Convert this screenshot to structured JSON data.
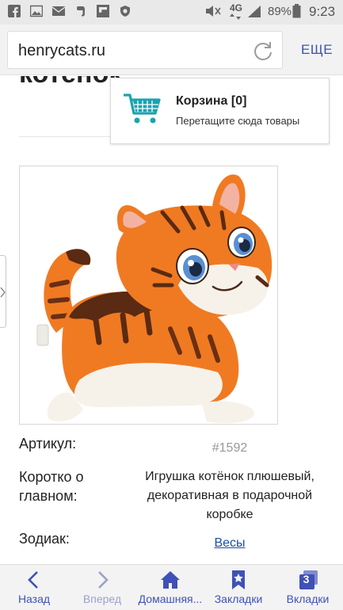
{
  "status_bar": {
    "network": "4G",
    "battery": "89%",
    "time": "9:23"
  },
  "browser": {
    "url": "henrycats.ru",
    "more_label": "ЕЩЕ"
  },
  "page": {
    "heading_partial": "котёнок",
    "cart": {
      "title": "Корзина [0]",
      "subtitle": "Перетащите сюда товары"
    },
    "details": {
      "sku_label": "Артикул:",
      "sku_value": "#1592",
      "summary_label_line1": "Коротко о",
      "summary_label_line2": "главном:",
      "summary_line1": "Игрушка котёнок плюшевый,",
      "summary_line2": "декоративная в подарочной",
      "summary_line3": "коробке",
      "zodiac_label": "Зодиак:",
      "zodiac_value": "Весы"
    }
  },
  "bottom_nav": {
    "back": "Назад",
    "forward": "Вперед",
    "home": "Домашняя...",
    "bookmarks": "Закладки",
    "tabs": "Вкладки",
    "tabs_count": "3"
  },
  "colors": {
    "accent": "#3f51b5",
    "cart": "#1aa3b0",
    "link": "#1e4fa0"
  }
}
